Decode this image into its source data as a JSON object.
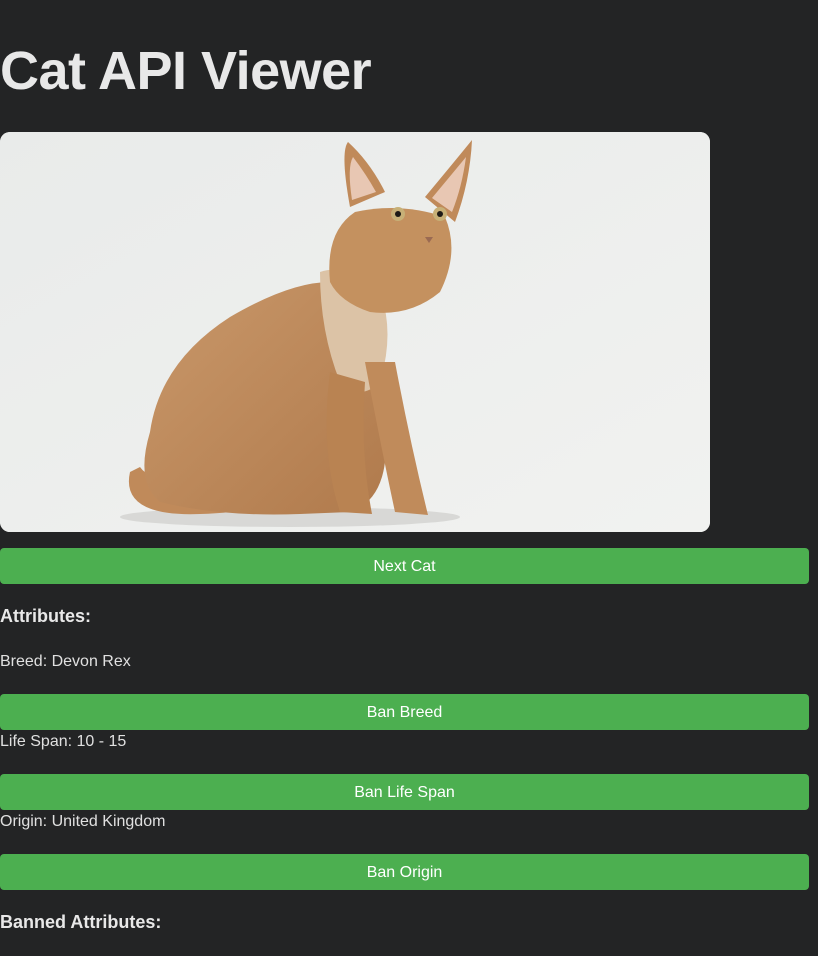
{
  "page": {
    "title": "Cat API Viewer"
  },
  "image": {
    "alt": "Devon Rex cat sitting, side view",
    "subject": "cat-photo"
  },
  "buttons": {
    "next": "Next Cat",
    "ban_breed": "Ban Breed",
    "ban_life_span": "Ban Life Span",
    "ban_origin": "Ban Origin"
  },
  "attributes": {
    "heading": "Attributes:",
    "breed": "Breed: Devon Rex",
    "life_span": "Life Span: 10 - 15",
    "origin": "Origin: United Kingdom"
  },
  "banned": {
    "heading": "Banned Attributes:"
  },
  "colors": {
    "accent": "#4caf50",
    "background": "#232425"
  }
}
